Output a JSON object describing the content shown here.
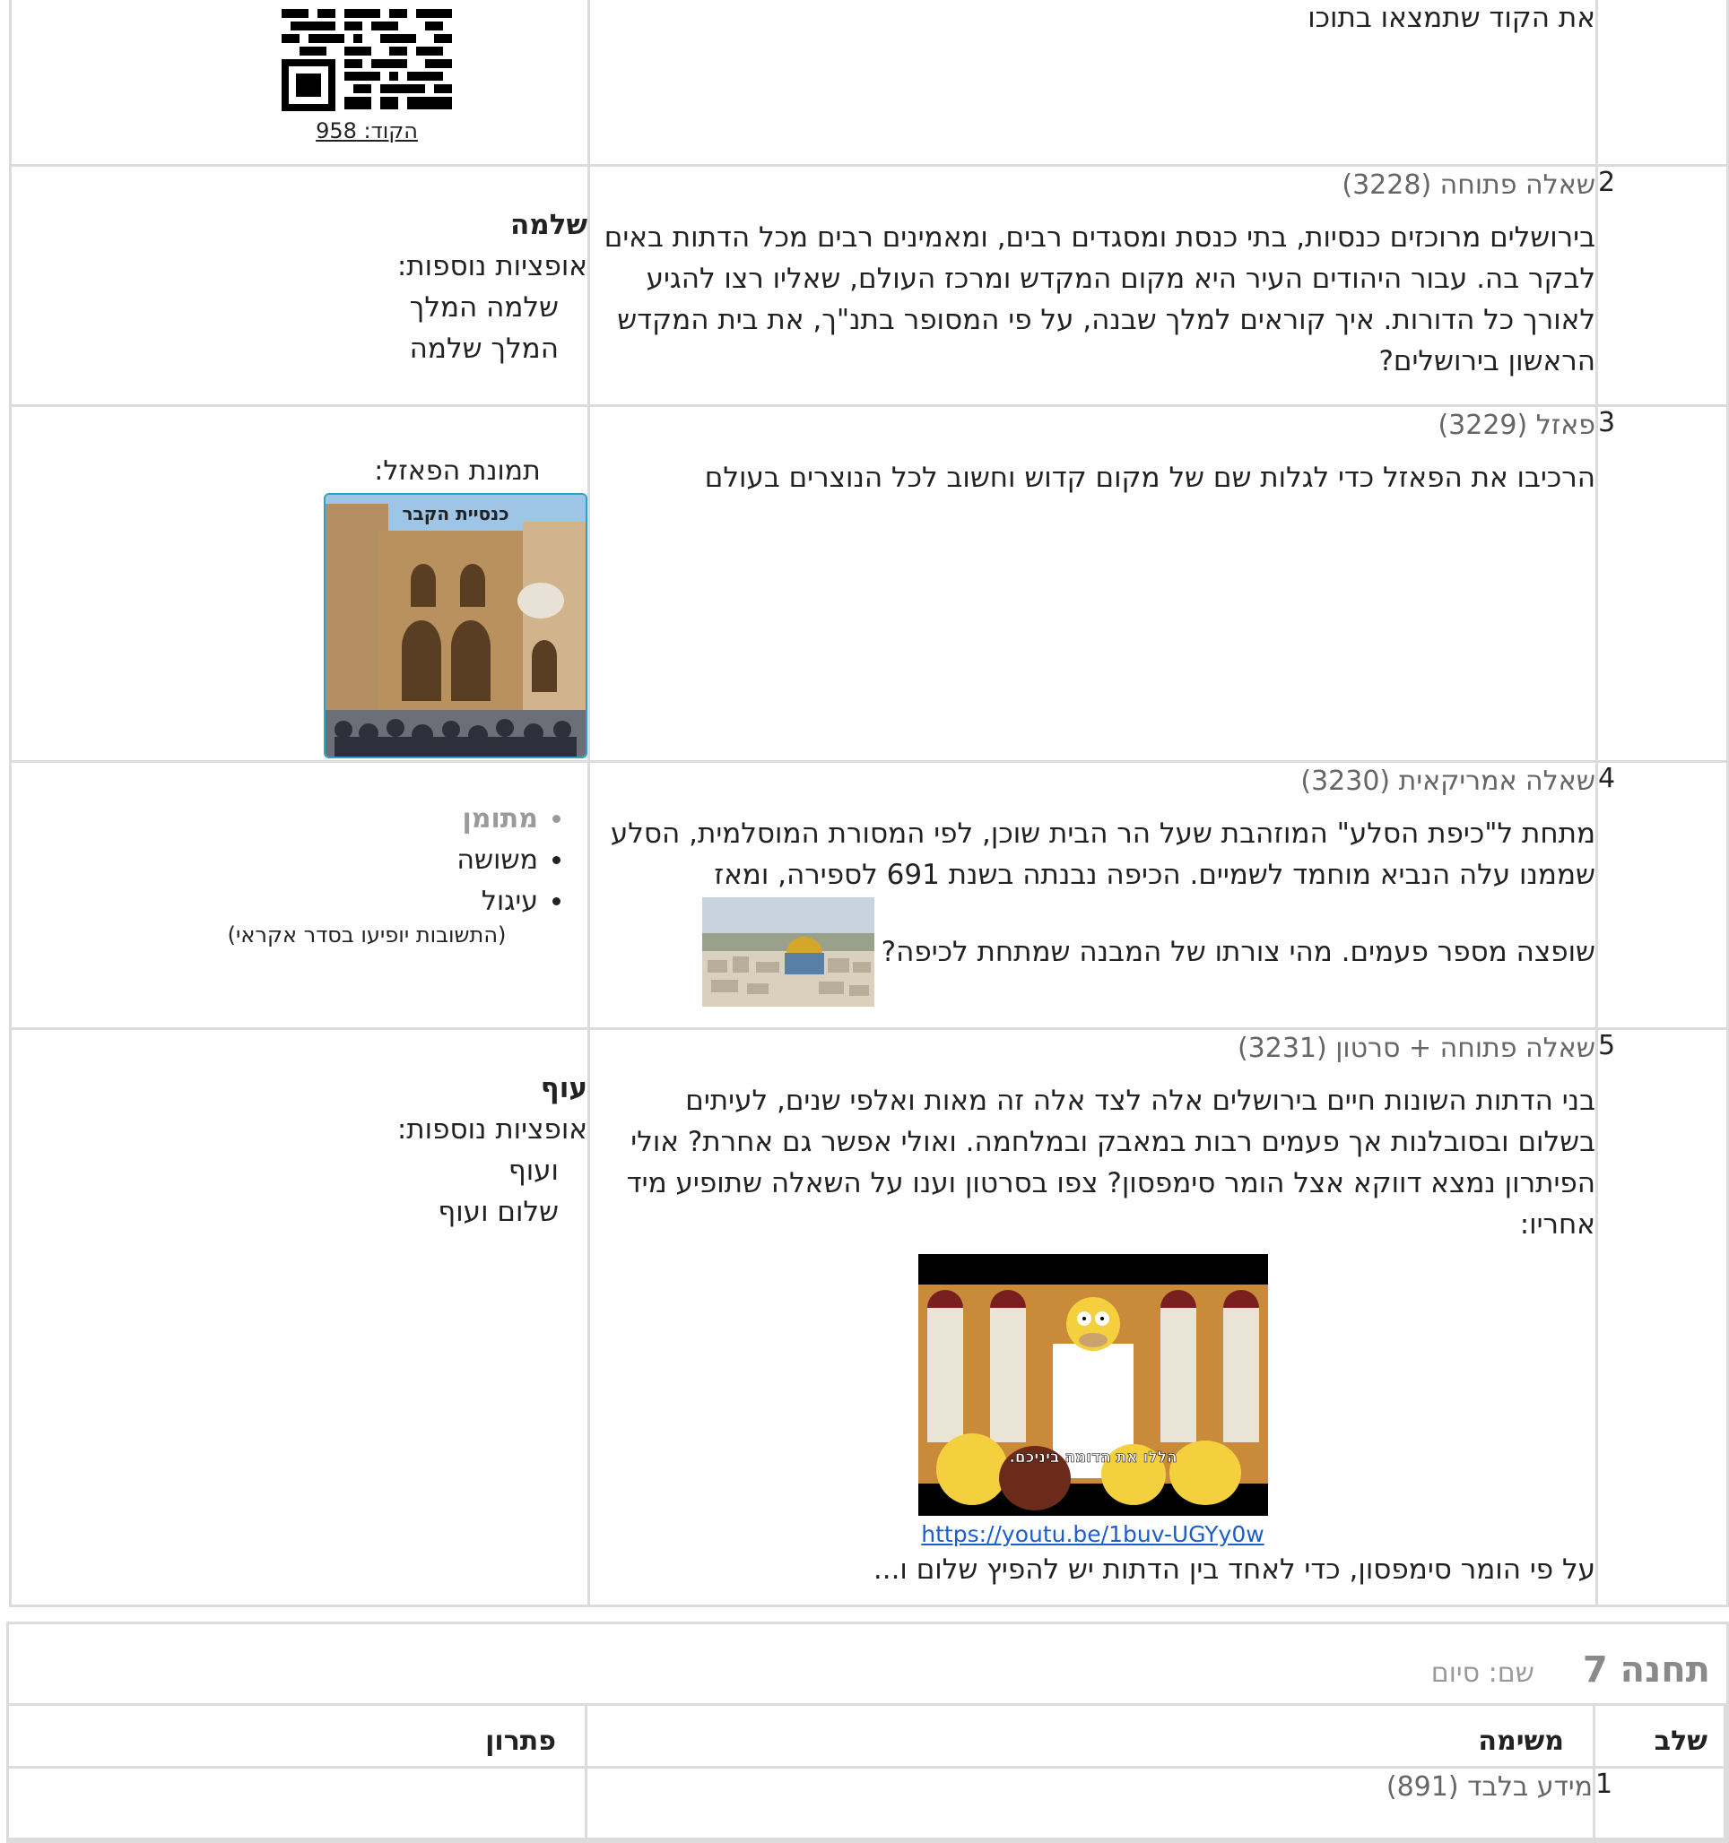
{
  "row1": {
    "task_tail": "את הקוד שתמצאו בתוכו",
    "code_label": "הקוד: 958"
  },
  "row2": {
    "num": "2",
    "type": "שאלה פתוחה (3228)",
    "text": "בירושלים מרוכזים כנסיות, בתי כנסת ומסגדים רבים, ומאמינים רבים מכל הדתות באים לבקר בה. עבור היהודים העיר היא מקום המקדש ומרכז העולם, שאליו רצו להגיע לאורך כל הדורות. איך קוראים למלך שבנה, על פי המסופר בתנ\"ך, את בית המקדש הראשון בירושלים?",
    "answer": "שלמה",
    "more_label": "אופציות נוספות:",
    "alt1": "שלמה המלך",
    "alt2": "המלך שלמה"
  },
  "row3": {
    "num": "3",
    "type": "פאזל (3229)",
    "text": "הרכיבו את הפאזל כדי לגלות שם של מקום קדוש וחשוב לכל הנוצרים בעולם",
    "image_label": "תמונת הפאזל:",
    "image_caption": "כנסיית הקבר"
  },
  "row4": {
    "num": "4",
    "type": "שאלה אמריקאית (3230)",
    "text1": "מתחת ל\"כיפת הסלע\" המוזהבת שעל הר הבית שוכן, לפי המסורת המוסלמית, הסלע שממנו עלה הנביא מוחמד לשמיים. הכיפה נבנתה בשנת 691 לספירה, ומאז",
    "text2": "שופצה מספר פעמים. מהי צורתו של המבנה שמתחת לכיפה?",
    "opt1": "מתומן",
    "opt2": "משושה",
    "opt3": "עיגול",
    "note": "(התשובות יופיעו בסדר אקראי)"
  },
  "row5": {
    "num": "5",
    "type": "שאלה פתוחה + סרטון (3231)",
    "text": "בני הדתות השונות חיים בירושלים אלה לצד אלה זה מאות ואלפי שנים, לעיתים בשלום ובסובלנות אך פעמים רבות במאבק ובמלחמה. ואולי אפשר גם אחרת? אולי הפיתרון נמצא דווקא אצל הומר סימפסון? צפו בסרטון וענו על השאלה שתופיע מיד אחריו:",
    "video_subtitle": "הללו את הדומה ביניכם.",
    "link": "https://youtu.be/1buv-UGYy0w",
    "question": "על פי הומר סימפסון, כדי לאחד בין הדתות יש להפיץ שלום ו...",
    "answer": "עוף",
    "more_label": "אופציות נוספות:",
    "alt1": "ועוף",
    "alt2": "שלום ועוף"
  },
  "station7": {
    "title": "תחנה 7",
    "name": "שם: סיום",
    "col_stage": "שלב",
    "col_task": "משימה",
    "col_solution": "פתרון",
    "row1_num": "1",
    "row1_type": "מידע בלבד (891)"
  }
}
